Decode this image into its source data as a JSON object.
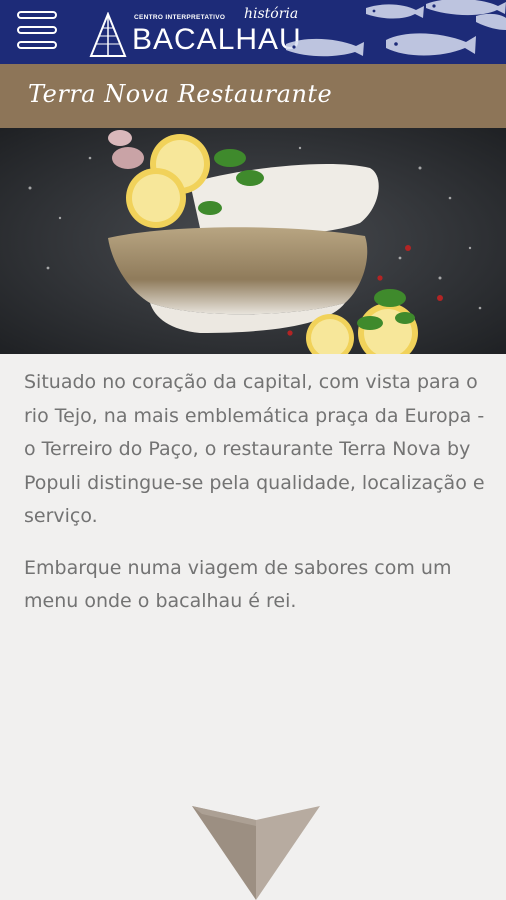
{
  "header": {
    "menu_icon": "hamburger-menu-icon",
    "logo": {
      "small_text": "CENTRO INTERPRETATIVO",
      "script_text": "história",
      "main_text": "BACALHAU"
    },
    "colors": {
      "background": "#1d2b78",
      "foreground": "#ffffff"
    }
  },
  "page": {
    "title": "Terra Nova Restaurante",
    "title_bar_color": "#8d7558"
  },
  "hero": {
    "description": "photo-of-codfish-fillets-with-lemon-and-herbs"
  },
  "content": {
    "paragraphs": [
      "Situado no coração da capital, com vista para o rio Tejo, na mais emblemática praça da Europa - o Terreiro do Paço, o restaurante Terra Nova by Populi distingue-se pela qualidade, localização e serviço.",
      "Embarque numa viagem de sabores com um menu onde o bacalhau é rei."
    ],
    "text_color": "#737373"
  },
  "footer": {
    "scroll_icon": "scroll-down-arrow-icon"
  }
}
